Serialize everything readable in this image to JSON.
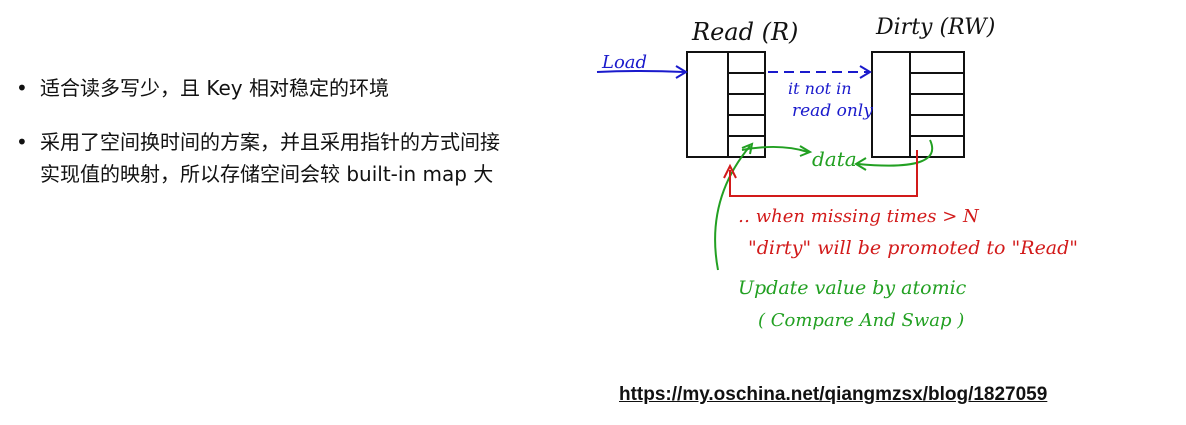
{
  "bullets": [
    "适合读多写少，且 Key 相对稳定的环境",
    "采用了空间换时间的方案，并且采用指针的方式间接实现值的映射，所以存储空间会较 built-in map 大"
  ],
  "diagram": {
    "read_label": "Read (R)",
    "dirty_label": "Dirty  (RW)",
    "load_label": "Load",
    "note_line1": "it not in",
    "note_line2": "read only",
    "data_label": "data",
    "red_line1": "‥ when missing times > N",
    "red_line2": "\"dirty\" will be promoted to \"Read\"",
    "green_line1": "Update value by atomic",
    "green_line2": "( Compare And Swap )",
    "colors": {
      "ink": "#111111",
      "blue": "#1a1acc",
      "green": "#22a022",
      "red": "#d21a1a"
    }
  },
  "link": {
    "text": "https://my.oschina.net/qiangmzsx/blog/1827059"
  }
}
